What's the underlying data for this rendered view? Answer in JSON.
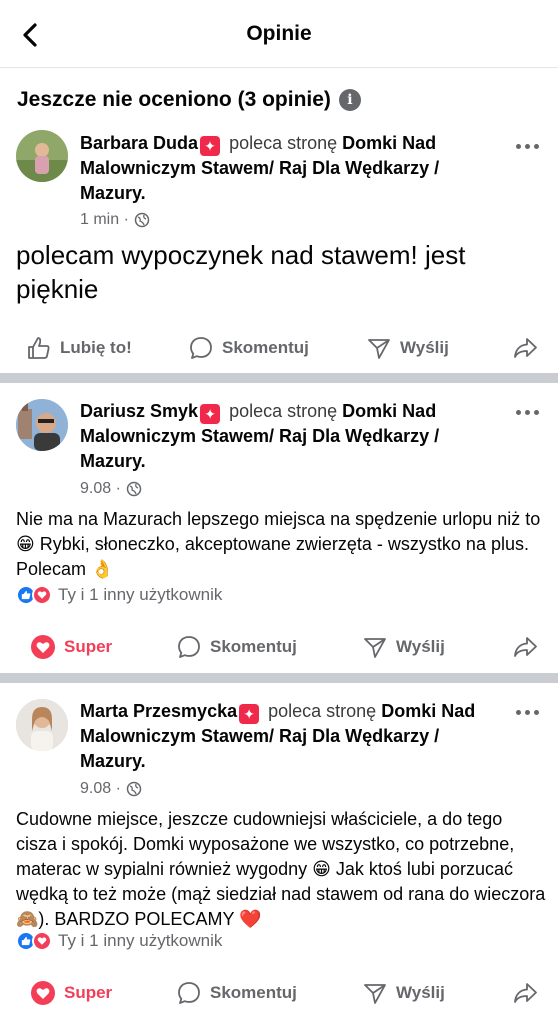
{
  "header": {
    "title": "Opinie"
  },
  "section": {
    "title": "Jeszcze nie oceniono (3 opinie)"
  },
  "posts": [
    {
      "author": "Barbara Duda",
      "recommends": "poleca stronę",
      "page": "Domki Nad Malowniczym Stawem/ Raj Dla Wędkarzy / Mazury.",
      "time": "1 min ·",
      "text": "polecam wypoczynek nad stawem! jest pięknie",
      "actions": {
        "like": "Lubię to!",
        "comment": "Skomentuj",
        "send": "Wyślij"
      }
    },
    {
      "author": "Dariusz Smyk",
      "recommends": "poleca stronę",
      "page": "Domki Nad Malowniczym Stawem/ Raj Dla Wędkarzy / Mazury.",
      "time": "9.08 ·",
      "text": "Nie ma na Mazurach lepszego miejsca na spędzenie urlopu niż to 😁 Rybki, słoneczko, akceptowane zwierzęta - wszystko na plus. Polecam 👌",
      "reactions": "Ty i 1 inny użytkownik",
      "actions": {
        "like": "Super",
        "comment": "Skomentuj",
        "send": "Wyślij"
      }
    },
    {
      "author": "Marta Przesmycka",
      "recommends": "poleca stronę",
      "page": "Domki Nad Malowniczym Stawem/ Raj Dla Wędkarzy / Mazury.",
      "time": "9.08 ·",
      "text": "Cudowne miejsce, jeszcze cudowniejsi właściciele, a do tego cisza i spokój. Domki wyposażone we wszystko, co potrzebne, materac w sypialni również wygodny 😁 Jak ktoś lubi porzucać wędką to też może (mąż siedział nad stawem od rana do wieczora🙈). BARDZO POLECAMY ❤️",
      "reactions": "Ty i 1 inny użytkownik",
      "actions": {
        "like": "Super",
        "comment": "Skomentuj",
        "send": "Wyślij"
      }
    }
  ],
  "icons": {
    "back": "chevron-left-icon",
    "info": "info-icon",
    "badge": "recommend-badge-icon",
    "globe": "globe-icon",
    "more": "more-dots-icon",
    "like": "thumbs-up-icon",
    "super": "heart-icon",
    "comment": "comment-bubble-icon",
    "send": "send-icon",
    "share": "share-arrow-icon"
  },
  "colors": {
    "accent": "#1877f2",
    "love": "#f33e58",
    "badge": "#f0284a",
    "muted": "#65676b",
    "divider": "#c9ccd1"
  }
}
